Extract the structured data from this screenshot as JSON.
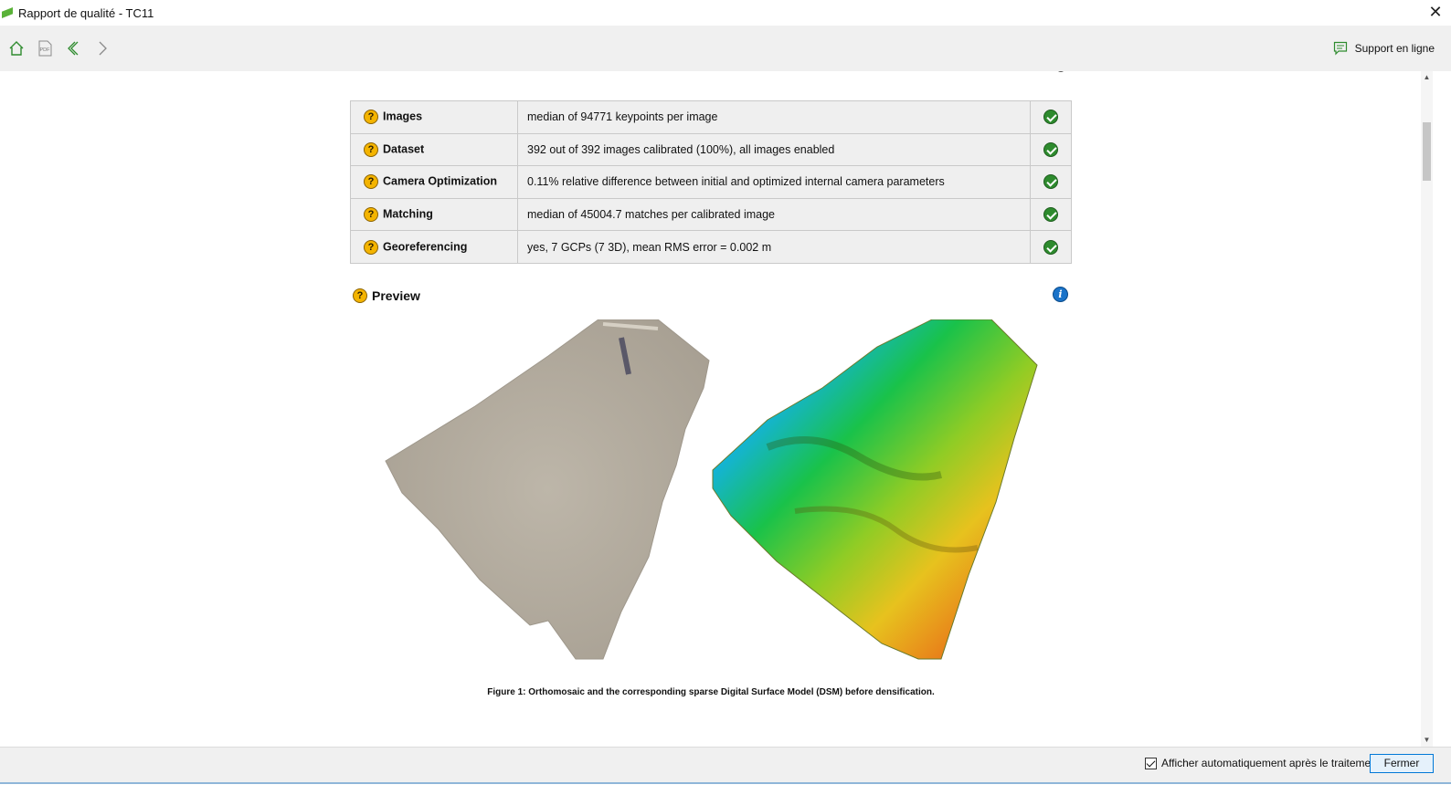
{
  "window": {
    "title": "Rapport de qualité - TC11",
    "close_glyph": "✕"
  },
  "toolbar": {
    "support_label": "Support en ligne",
    "pdf_text": "PDF"
  },
  "summary": {
    "rows": [
      {
        "name": "Images",
        "desc": "median of 94771 keypoints per image",
        "status": "ok"
      },
      {
        "name": "Dataset",
        "desc": "392 out of 392 images calibrated (100%), all images enabled",
        "status": "ok"
      },
      {
        "name": "Camera Optimization",
        "desc": "0.11% relative difference between initial and optimized internal camera parameters",
        "status": "ok"
      },
      {
        "name": "Matching",
        "desc": "median of 45004.7 matches per calibrated image",
        "status": "ok"
      },
      {
        "name": "Georeferencing",
        "desc": "yes, 7 GCPs (7 3D), mean RMS error = 0.002 m",
        "status": "ok"
      }
    ],
    "help_glyph": "?"
  },
  "preview": {
    "title": "Preview",
    "info_glyph": "i",
    "caption": "Figure 1: Orthomosaic and the corresponding sparse Digital Surface Model (DSM) before densification."
  },
  "footer": {
    "auto_show_label": "Afficher automatiquement après le traitement",
    "auto_show_checked": true,
    "close_label": "Fermer"
  },
  "colors": {
    "accent": "#0078d7",
    "ok": "#2e8b2e",
    "help": "#f4b400",
    "info": "#1a73c9"
  }
}
